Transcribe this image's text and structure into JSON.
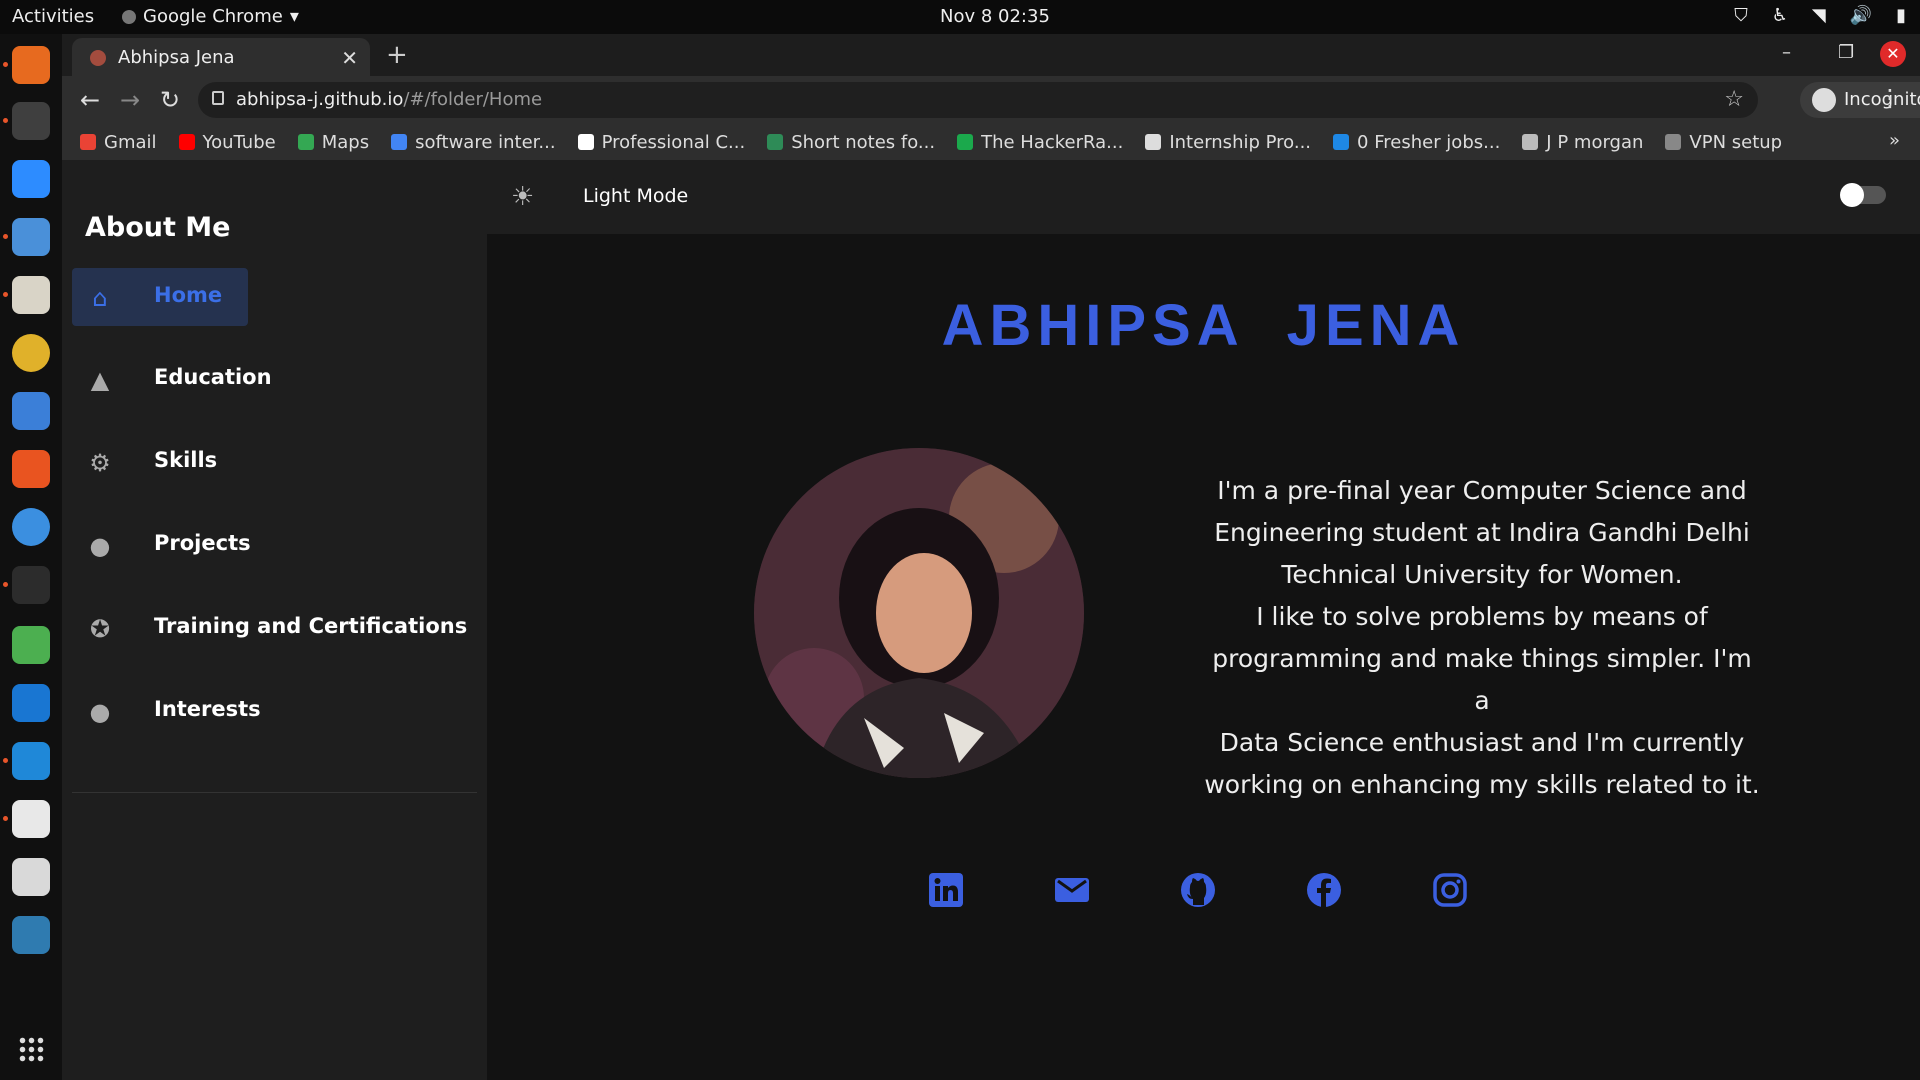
{
  "topbar": {
    "activities": "Activities",
    "app": "Google Chrome",
    "clock": "Nov 8  02:35"
  },
  "browser": {
    "tab_title": "Abhipsa Jena",
    "url_host": "abhipsa-j.github.io",
    "url_path": "/#/folder/Home",
    "profile": "Incognito",
    "bookmarks": [
      {
        "label": "Gmail",
        "color": "#ea4335"
      },
      {
        "label": "YouTube",
        "color": "#ff0000"
      },
      {
        "label": "Maps",
        "color": "#34a853"
      },
      {
        "label": "software inter...",
        "color": "#4285f4"
      },
      {
        "label": "Professional C...",
        "color": "#ffffff"
      },
      {
        "label": "Short notes fo...",
        "color": "#2e8b57"
      },
      {
        "label": "The HackerRa...",
        "color": "#1ba94c"
      },
      {
        "label": "Internship Pro...",
        "color": "#dddddd"
      },
      {
        "label": "0 Fresher jobs...",
        "color": "#1e88e5"
      },
      {
        "label": "J P morgan",
        "color": "#bbbbbb"
      },
      {
        "label": "VPN setup",
        "color": "#888888"
      }
    ]
  },
  "sidebar": {
    "heading": "About Me",
    "items": [
      {
        "label": "Home",
        "icon": "home-icon"
      },
      {
        "label": "Education",
        "icon": "graduation-cap-icon"
      },
      {
        "label": "Skills",
        "icon": "gear-icon"
      },
      {
        "label": "Projects",
        "icon": "lightbulb-icon"
      },
      {
        "label": "Training and Certifications",
        "icon": "award-icon"
      },
      {
        "label": "Interests",
        "icon": "apple-icon"
      }
    ]
  },
  "modebar": {
    "label": "Light Mode"
  },
  "profile": {
    "name": "ABHIPSA  JENA",
    "bio_lines": [
      "I'm a pre-final year Computer Science and",
      "Engineering student at Indira Gandhi Delhi",
      "Technical University for Women.",
      "I like to solve problems by means of",
      "programming and make things simpler. I'm a",
      "Data Science enthusiast and I'm currently",
      "working on enhancing my skills related to it."
    ]
  },
  "socials": [
    "linkedin-icon",
    "mail-icon",
    "github-icon",
    "facebook-icon",
    "instagram-icon"
  ],
  "colors": {
    "accent": "#3b5fe0",
    "sidebar_active": "#25324f",
    "background": "#121212"
  }
}
